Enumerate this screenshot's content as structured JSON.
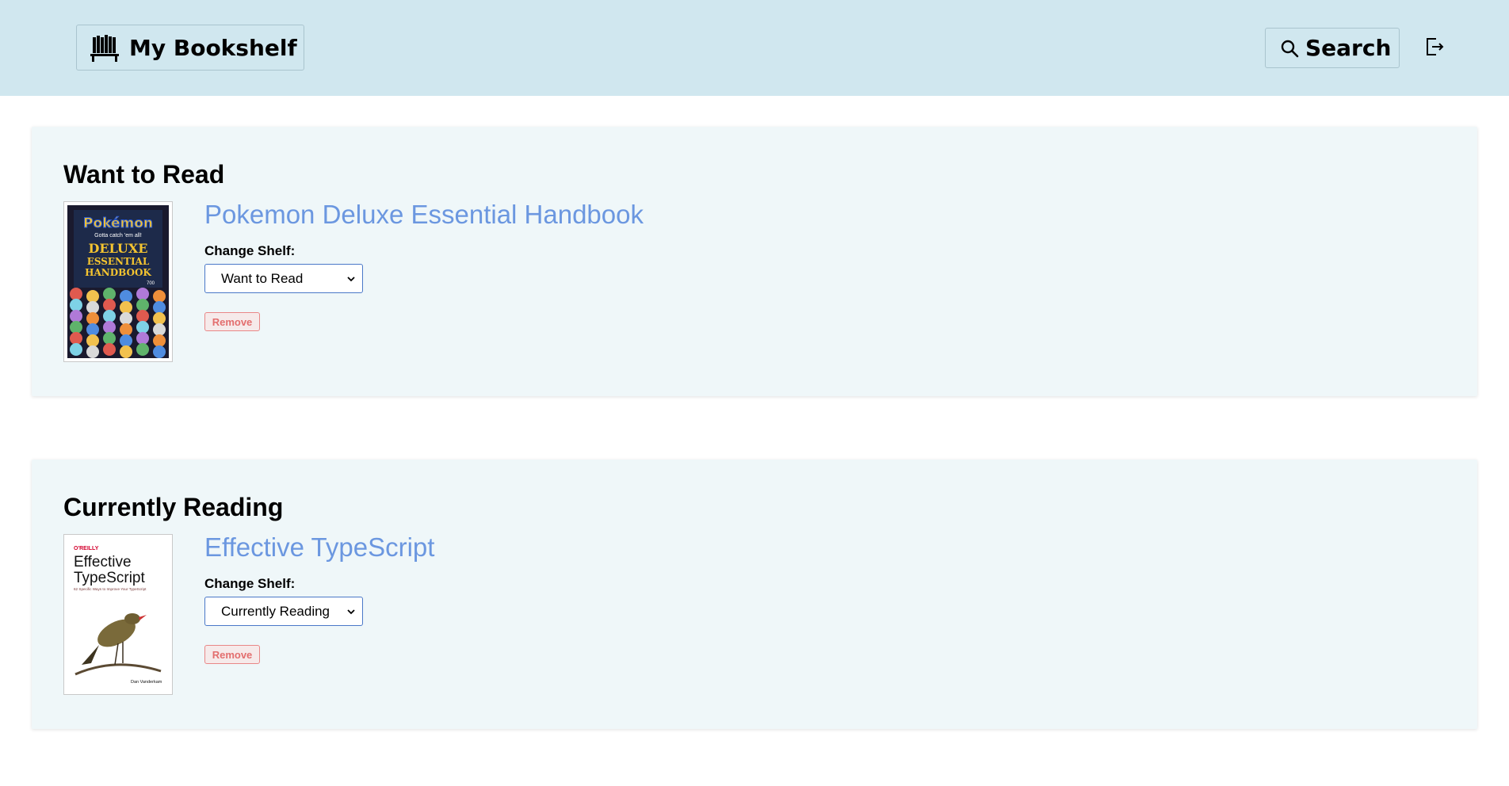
{
  "header": {
    "brand_label": "My Bookshelf",
    "brand_icon": "bookshelf-icon",
    "search_label": "Search",
    "search_icon": "search-icon",
    "logout_icon": "logout-icon",
    "background": "#d0e7ef"
  },
  "shelves": [
    {
      "title": "Want to Read",
      "books": [
        {
          "title": "Pokemon Deluxe Essential Handbook",
          "cover_lines": [
            "Pokémon",
            "Gotta catch 'em all!",
            "DELUXE",
            "ESSENTIAL",
            "HANDBOOK",
            "700"
          ],
          "change_label": "Change Shelf:",
          "selected": "Want to Read",
          "remove_label": "Remove"
        }
      ]
    },
    {
      "title": "Currently Reading",
      "books": [
        {
          "title": "Effective TypeScript",
          "cover_lines": [
            "O'REILLY",
            "Effective",
            "TypeScript",
            "62 Specific Ways to Improve Your TypeScript",
            "Dan Vanderkam"
          ],
          "change_label": "Change Shelf:",
          "selected": "Currently Reading",
          "remove_label": "Remove"
        }
      ]
    }
  ],
  "colors": {
    "title_link": "#6b97e0",
    "remove": "#e36e6e",
    "shelf_bg": "#eff7f9"
  }
}
